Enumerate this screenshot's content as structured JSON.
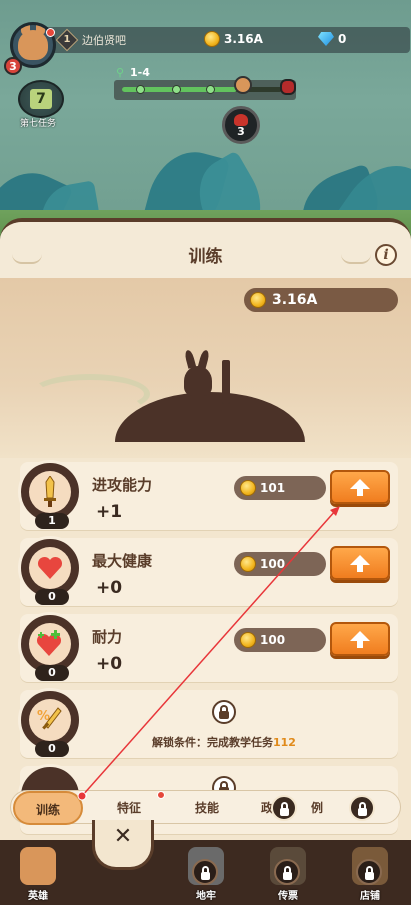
{
  "hud": {
    "player_rank": "1",
    "player_name": "边伯贤吧",
    "player_level": "3",
    "gold": "3.16A",
    "gems": "0",
    "mission_label": "第七任务",
    "mission_number": "7",
    "stage_label": "1-4",
    "stage_progress": 0.72,
    "boss_counter": "3"
  },
  "panel": {
    "title": "训练",
    "info_icon": "i",
    "gold_amount": "3.16A"
  },
  "stats": [
    {
      "name": "进攻能力",
      "value": "+1",
      "level": "1",
      "cost": "101",
      "icon": "sword-icon",
      "locked": false
    },
    {
      "name": "最大健康",
      "value": "+0",
      "level": "0",
      "cost": "100",
      "icon": "heart-icon",
      "locked": false
    },
    {
      "name": "耐力",
      "value": "+0",
      "level": "0",
      "cost": "100",
      "icon": "heart-plus-icon",
      "locked": false
    },
    {
      "name": "",
      "value": "",
      "level": "0",
      "cost": "",
      "icon": "percent-sword-icon",
      "locked": true,
      "unlock_text": "解锁条件：完成教学任务",
      "unlock_num": "112"
    }
  ],
  "tabs": [
    {
      "label": "训练",
      "active": true
    },
    {
      "label": "特征",
      "active": false
    },
    {
      "label": "技能",
      "active": false
    },
    {
      "label": "政",
      "active": false,
      "locked": true
    },
    {
      "label": "例",
      "active": false
    },
    {
      "label": "",
      "active": false,
      "locked": true
    }
  ],
  "nav": [
    {
      "label": "英雄"
    },
    {
      "label": "地牢"
    },
    {
      "label": "传票"
    },
    {
      "label": "店铺"
    }
  ],
  "close_glyph": "✕",
  "colors": {
    "accent_orange": "#f07d1f",
    "panel_bg": "#f3e6cf",
    "dark_brown": "#3d2a20",
    "red_dot": "#e5473a"
  }
}
